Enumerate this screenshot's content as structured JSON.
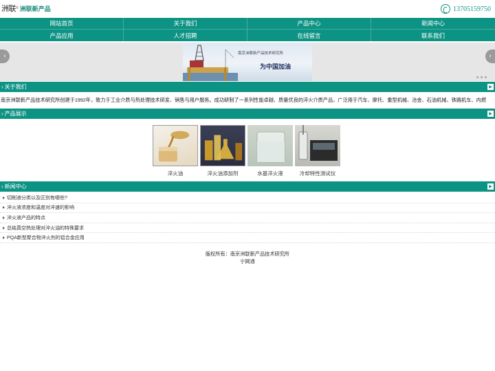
{
  "header": {
    "logo_mark": "洲联",
    "logo_sup": "®",
    "logo_name": "洲联新产品",
    "phone": "13705159750",
    "phone_icon": "phone-icon"
  },
  "nav": [
    {
      "label": "网站首页"
    },
    {
      "label": "关于我们"
    },
    {
      "label": "产品中心"
    },
    {
      "label": "新闻中心"
    },
    {
      "label": "产品应用"
    },
    {
      "label": "人才招聘"
    },
    {
      "label": "在线留言"
    },
    {
      "label": "联系我们"
    }
  ],
  "banner": {
    "caption": "南京洲联新产品技术研究所",
    "slogan": "为中国加油",
    "prev_icon": "chevron-left-icon",
    "next_icon": "chevron-right-icon",
    "slide_count": 3
  },
  "about": {
    "title": "关于我们",
    "text": "南京洲联新产品技术研究所创建于1992年，致力于工业介质与热处理技术研发、销售与用户服务。成功研制了一系列性能卓越、质量优良的淬火介质产品，广泛用于汽车、摩托、重型机械、冶金、石油机械、铁路机车、内燃"
  },
  "products": {
    "title": "产品展示",
    "items": [
      {
        "name": "淬火油"
      },
      {
        "name": "淬火油添加剂"
      },
      {
        "name": "水基淬火液"
      },
      {
        "name": "冷却特性测试仪"
      }
    ]
  },
  "news": {
    "title": "新闻中心",
    "items": [
      {
        "title": "切削液分类以及区别有哪些?"
      },
      {
        "title": "淬火液浓度和温度对淬速的影响"
      },
      {
        "title": "淬火液产品的特点"
      },
      {
        "title": "总结真空热处理对淬火油的特殊要求"
      },
      {
        "title": "PQA新型聚合物淬火剂的铝合金应用"
      }
    ]
  },
  "footer": {
    "copyright": "版权所有：南京洲联新产品技术研究所",
    "provider": "宁网通"
  },
  "colors": {
    "brand": "#0d9384",
    "nav_divider": "#43aea2",
    "banner_bg": "#e6e6e6"
  }
}
